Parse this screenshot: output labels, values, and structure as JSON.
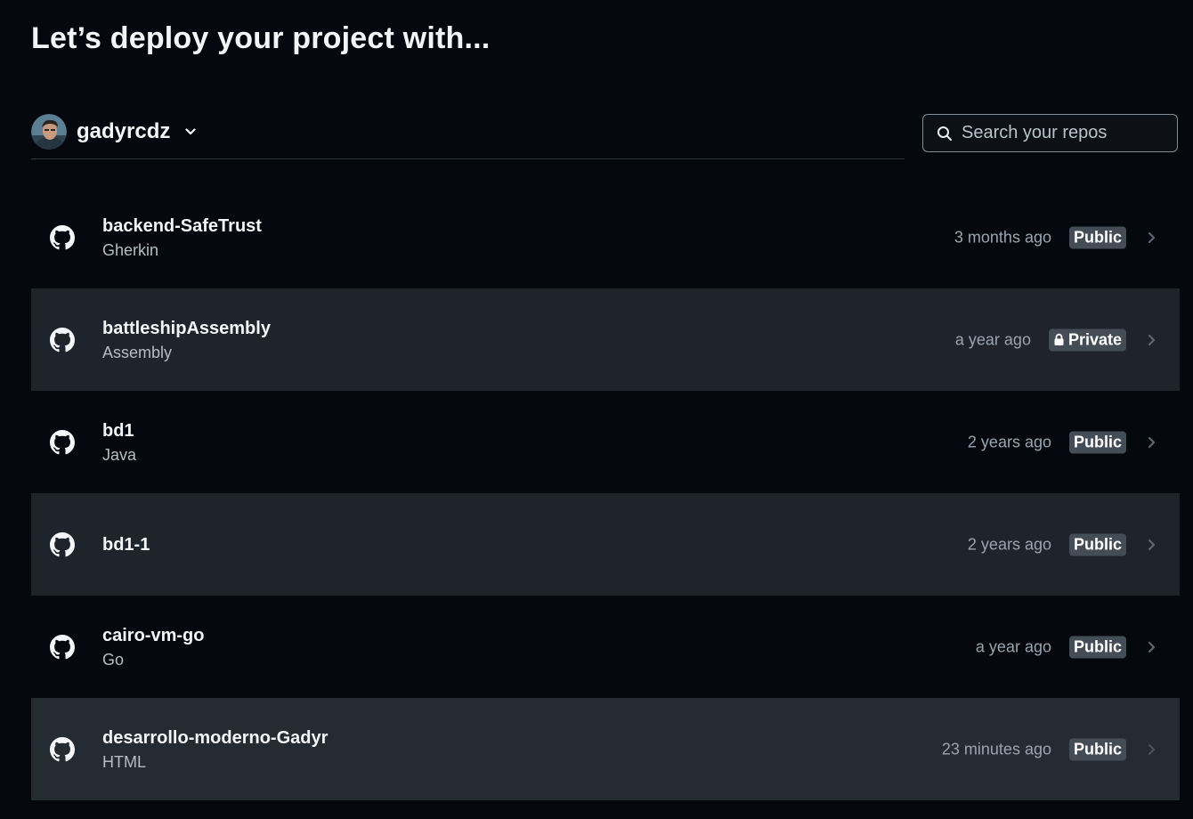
{
  "page": {
    "title": "Let’s deploy your project with..."
  },
  "account": {
    "name": "gadyrcdz",
    "avatar_icon": "user-avatar",
    "dropdown_icon": "chevron-down-icon"
  },
  "search": {
    "placeholder": "Search your repos",
    "value": "",
    "icon": "search-icon"
  },
  "repos": [
    {
      "name": "backend-SafeTrust",
      "language": "Gherkin",
      "updated": "3 months ago",
      "visibility": "Public"
    },
    {
      "name": "battleshipAssembly",
      "language": "Assembly",
      "updated": "a year ago",
      "visibility": "Private"
    },
    {
      "name": "bd1",
      "language": "Java",
      "updated": "2 years ago",
      "visibility": "Public"
    },
    {
      "name": "bd1-1",
      "language": "",
      "updated": "2 years ago",
      "visibility": "Public"
    },
    {
      "name": "cairo-vm-go",
      "language": "Go",
      "updated": "a year ago",
      "visibility": "Public"
    },
    {
      "name": "desarrollo-moderno-Gadyr",
      "language": "HTML",
      "updated": "23 minutes ago",
      "visibility": "Public"
    }
  ],
  "colors": {
    "background": "#05090f",
    "row_shaded": "#1f242c",
    "row_shaded_2": "#252b33",
    "badge": "#444c56",
    "muted_text": "#9aa4af"
  }
}
